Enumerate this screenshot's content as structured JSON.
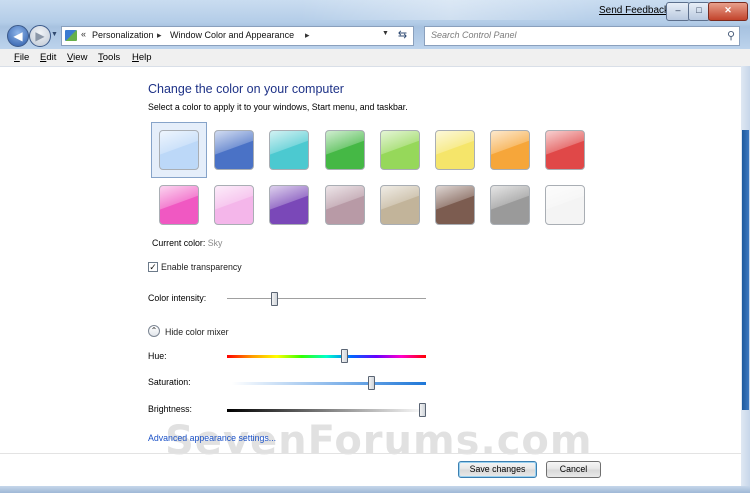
{
  "titlebar": {
    "send_feedback": "Send Feedback",
    "min_symbol": "–",
    "max_symbol": "□",
    "close_symbol": "✕"
  },
  "nav": {
    "back_symbol": "◀",
    "forward_symbol": "▶",
    "dropdown_symbol": "▼"
  },
  "address": {
    "chevron": "«",
    "crumbs": [
      "Personalization",
      "Window Color and Appearance"
    ],
    "sep": "▸",
    "dropdown_symbol": "▼",
    "refresh_symbol": "⇆"
  },
  "search": {
    "placeholder": "Search Control Panel",
    "icon_symbol": "⚲"
  },
  "menu": {
    "file": {
      "u": "F",
      "rest": "ile"
    },
    "edit": {
      "u": "E",
      "rest": "dit"
    },
    "view": {
      "u": "V",
      "rest": "iew"
    },
    "tools": {
      "u": "T",
      "rest": "ools"
    },
    "help": {
      "u": "H",
      "rest": "elp"
    }
  },
  "content": {
    "heading": "Change the color on your computer",
    "subtitle": "Select a color to apply it to your windows, Start menu, and taskbar.",
    "current_color_label": "Current color: ",
    "current_color_value": "Sky",
    "transparency_checked": true,
    "checkmark": "✓",
    "transparency_label": "Enable transparency",
    "intensity_label": "Color intensity:",
    "mixer_symbol": "⌃",
    "mixer_label": "Hide color mixer",
    "hue_label": "Hue:",
    "saturation_label": "Saturation:",
    "brightness_label": "Brightness:",
    "advanced_link": "Advanced appearance settings...",
    "watermark": "SevenForums.com"
  },
  "sliders": {
    "intensity": 0.24,
    "hue": 0.59,
    "saturation": 0.72,
    "brightness": 0.98
  },
  "swatches": {
    "selected_index": 0,
    "colors": [
      "#bcd8f8",
      "#4a72c6",
      "#4cc9d0",
      "#45b845",
      "#96d85a",
      "#f5e56a",
      "#f6a63a",
      "#e04848",
      "#f058c2",
      "#f4b6ea",
      "#7a48b8",
      "#b89aa6",
      "#c2b49a",
      "#7c5c50",
      "#9a9a9a",
      "#f4f4f4"
    ]
  },
  "buttons": {
    "save": "Save changes",
    "cancel": "Cancel"
  }
}
